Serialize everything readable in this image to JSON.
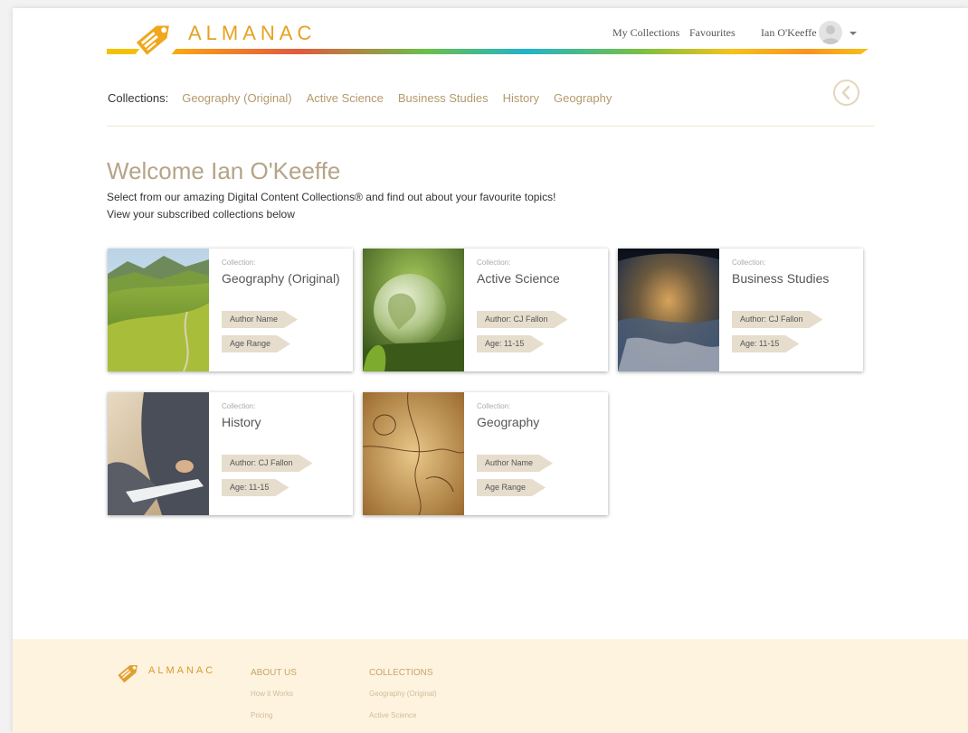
{
  "header": {
    "logo_text": "ALMANAC",
    "nav": {
      "my_collections": "My Collections",
      "favourites": "Favourites",
      "user_name": "Ian O'Keeffe"
    }
  },
  "collections_bar": {
    "label": "Collections:",
    "items": [
      "Geography (Original)",
      "Active Science",
      "Business Studies",
      "History",
      "Geography"
    ]
  },
  "welcome": {
    "title": "Welcome Ian O'Keeffe",
    "line1": "Select from our amazing Digital Content Collections® and find out about your favourite topics!",
    "line2": "View your subscribed collections below"
  },
  "cards": [
    {
      "label": "Collection:",
      "title": "Geography (Original)",
      "tag1": "Author Name",
      "tag2": "Age Range"
    },
    {
      "label": "Collection:",
      "title": "Active Science",
      "tag1": "Author: CJ Fallon",
      "tag2": "Age: 11-15"
    },
    {
      "label": "Collection:",
      "title": "Business Studies",
      "tag1": "Author: CJ Fallon",
      "tag2": "Age: 11-15"
    },
    {
      "label": "Collection:",
      "title": "History",
      "tag1": "Author: CJ Fallon",
      "tag2": "Age: 11-15"
    },
    {
      "label": "Collection:",
      "title": "Geography",
      "tag1": "Author Name",
      "tag2": "Age Range"
    }
  ],
  "footer": {
    "logo_text": "ALMANAC",
    "about": {
      "heading": "ABOUT US",
      "links": [
        "How it Works",
        "Pricing"
      ]
    },
    "collections": {
      "heading": "COLLECTIONS",
      "links": [
        "Geography (Original)",
        "Active Science"
      ]
    }
  },
  "colors": {
    "brand_orange": "#e8a020",
    "link_tan": "#b39a6b",
    "footer_bg": "#fdf3df",
    "tag_bg": "#e6ddcd"
  }
}
